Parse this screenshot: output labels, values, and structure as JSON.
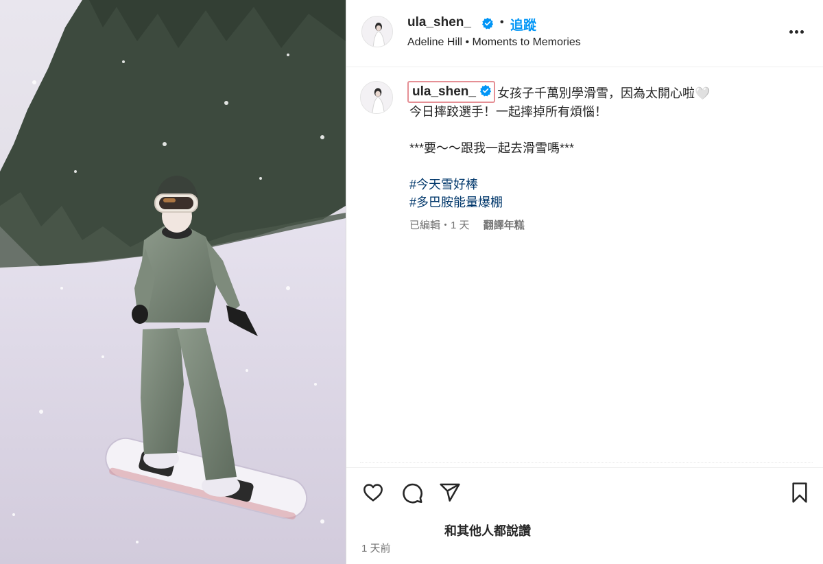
{
  "post": {
    "username": "ula_shen_",
    "follow_label": "追蹤",
    "separator": "•",
    "subline": "Adeline Hill • Moments to Memories"
  },
  "caption": {
    "username": "ula_shen_",
    "line1": "女孩子千萬別學滑雪，因為太開心啦🤍",
    "line2": "今日摔跤選手！一起摔掉所有煩惱！",
    "line3": "***要～～跟我一起去滑雪嗎***",
    "hashtags": [
      "#今天雪好棒",
      "#多巴胺能量爆棚"
    ],
    "edited": "已編輯・1 天",
    "see_translation": "翻譯年糕"
  },
  "actions": {
    "icons": [
      "heart-icon",
      "comment-icon",
      "share-icon",
      "bookmark-icon"
    ],
    "likes_text": "和其他人都說讚",
    "timestamp": "1 天前"
  },
  "colors": {
    "accent": "#0095f6",
    "verified": "#0095f6",
    "hashtag": "#00376b",
    "highlight_box": "#e58f95"
  }
}
